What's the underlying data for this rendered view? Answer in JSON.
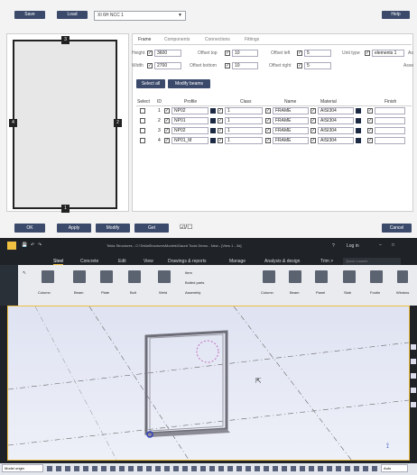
{
  "dialog": {
    "save_label": "Save",
    "load_label": "Load",
    "preset_value": "XI 6H NCC 1",
    "help_label": "Help",
    "tabs": [
      "Frame",
      "Components",
      "Connections",
      "Fittings"
    ],
    "fields": {
      "height_label": "Height",
      "height_value": "3600",
      "width_label": "Width",
      "width_value": "2700",
      "offset_top_label": "Offset top",
      "offset_top_value": "10",
      "offset_bottom_label": "Offset bottom",
      "offset_bottom_value": "10",
      "offset_left_label": "Offset left",
      "offset_left_value": "5",
      "offset_right_label": "Offset right",
      "offset_right_value": "5",
      "unit_type_label": "Unit type",
      "unit_type_value": "elements 1",
      "cut_label_a": "As",
      "cut_label_b": "Asse"
    },
    "select_all_label": "Select all",
    "modify_beams_label": "Modify beams",
    "table_headers": [
      "Select",
      "ID",
      "Profile",
      "Class",
      "Name",
      "Material",
      "Finish"
    ],
    "rows": [
      {
        "id": "1",
        "profile": "NP02",
        "cls": "1",
        "name": "FRAME",
        "material": "AISI304"
      },
      {
        "id": "2",
        "profile": "NP01",
        "cls": "1",
        "name": "FRAME",
        "material": "AISI304"
      },
      {
        "id": "3",
        "profile": "NP02",
        "cls": "1",
        "name": "FRAME",
        "material": "AISI304"
      },
      {
        "id": "4",
        "profile": "NP01_M",
        "cls": "1",
        "name": "FRAME",
        "material": "AISI304"
      }
    ],
    "preview_markers": {
      "top": "3",
      "left": "4",
      "right": "2",
      "bottom": "1"
    },
    "ok_label": "OK",
    "apply_label": "Apply",
    "modify_label": "Modify",
    "get_label": "Get",
    "toggle_label": "☑/☐",
    "cancel_label": "Cancel"
  },
  "tekla": {
    "title": "Tekla Structures - C:\\TeklaStructuresModels\\Gaurd Tools Demo - New - [View 1 - 3d]",
    "search_placeholder": "Quick Launch",
    "login_label": "Log in",
    "ribbon_tabs": [
      "Steel",
      "Concrete",
      "Edit",
      "View",
      "Drawings & reports",
      "Manage",
      "Analysis & design",
      "Trim >"
    ],
    "active_tab": "Steel",
    "tools": [
      "Column",
      "Beam",
      "Plate",
      "Bolt",
      "Weld"
    ],
    "list_items": [
      "Item",
      "Bolted parts",
      "Assembly"
    ],
    "tools_right": [
      "Column",
      "Beam",
      "Panel",
      "Slab",
      "Footin",
      "Window"
    ],
    "status_left": "Model origin",
    "status_right": "Auto"
  }
}
